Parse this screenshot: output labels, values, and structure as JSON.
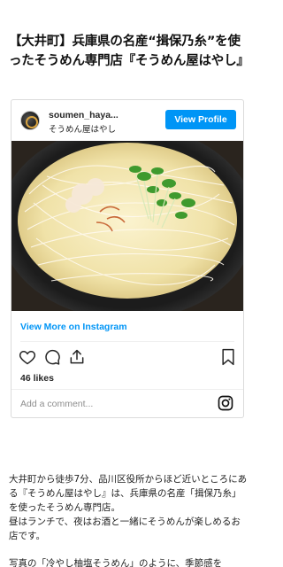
{
  "article": {
    "title": "【大井町】兵庫県の名産“揖保乃糸”を使ったそうめん専門店『そうめん屋はやし』"
  },
  "embed": {
    "username": "soumen_haya...",
    "sublabel": "そうめん屋はやし",
    "view_profile_label": "View Profile",
    "view_more_label": "View More on Instagram",
    "likes": "46 likes",
    "comment_placeholder": "Add a comment...",
    "photo_icon": "bowl-of-somen-photo",
    "accent_color": "#0095f6"
  },
  "body": {
    "paragraph1": "大井町から徒歩7分、品川区役所からほど近いところにある『そうめん屋はやし』は、兵庫県の名産「揖保乃糸」を使ったそうめん専門店。",
    "paragraph1b": "昼はランチで、夜はお酒と一緒にそうめんが楽しめるお店です。",
    "paragraph2": "写真の「冷やし柚塩そうめん」のように、季節感を"
  }
}
